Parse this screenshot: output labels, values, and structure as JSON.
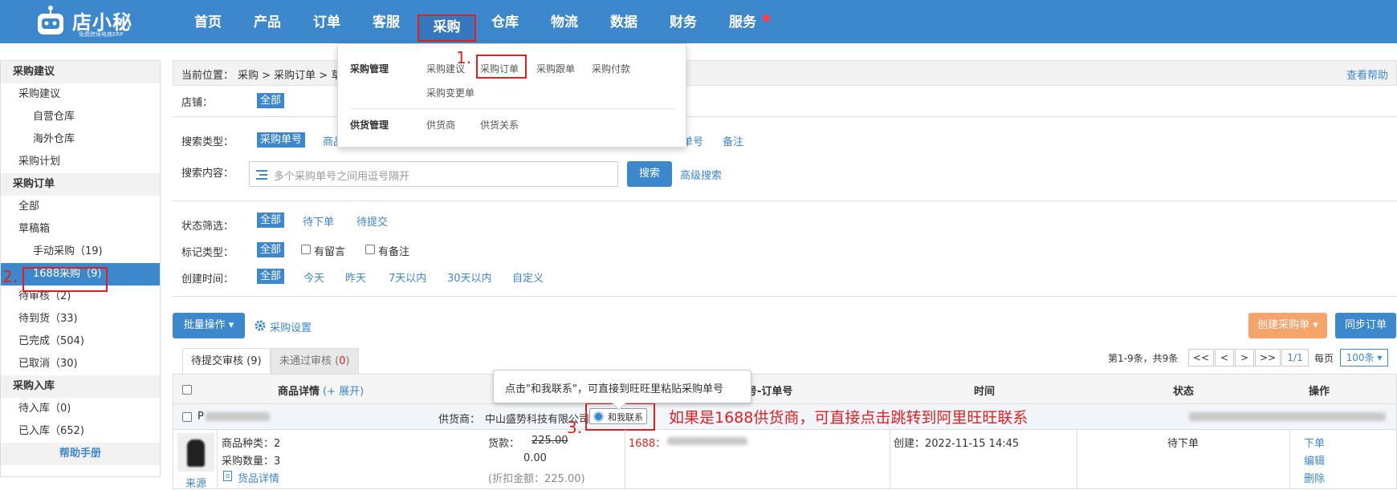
{
  "logo": {
    "name": "店小秘",
    "subtitle": "免费跨境电商ERP"
  },
  "nav": [
    "首页",
    "产品",
    "订单",
    "客服",
    "采购",
    "仓库",
    "物流",
    "数据",
    "财务",
    "服务"
  ],
  "sidebar": {
    "sections": [
      {
        "title": "采购建议",
        "items": [
          {
            "label": "采购建议"
          },
          {
            "label": "自营仓库"
          },
          {
            "label": "海外仓库"
          },
          {
            "label": "采购计划"
          }
        ]
      },
      {
        "title": "采购订单",
        "items": [
          {
            "label": "全部"
          },
          {
            "label": "草稿箱"
          },
          {
            "label": "手动采购（19)"
          },
          {
            "label": "1688采购（9)"
          },
          {
            "label": "待审核（2)"
          },
          {
            "label": "待到货（33)"
          },
          {
            "label": "已完成（504)"
          },
          {
            "label": "已取消（30)"
          }
        ]
      },
      {
        "title": "采购入库",
        "items": [
          {
            "label": "待入库（0)"
          },
          {
            "label": "已入库（652)"
          }
        ]
      }
    ],
    "help": "帮助手册"
  },
  "annotations": {
    "m1": "1.",
    "m2": "2.",
    "m3": "3.",
    "note": "如果是1688供货商，可直接点击跳转到阿里旺旺联系"
  },
  "breadcrumb": {
    "label": "当前位置：",
    "path": "采购 > 采购订单 > 草稿",
    "help": "查看帮助"
  },
  "dropdown": {
    "group1": "采购管理",
    "g1_items": [
      "采购建议",
      "采购订单",
      "采购跟单",
      "采购付款",
      "采购变更单"
    ],
    "group2": "供货管理",
    "g2_items": [
      "供货商",
      "供货关系"
    ]
  },
  "filters": {
    "shop_label": "店铺：",
    "shop_all": "全部",
    "type_label": "搜索类型：",
    "type_sel": "采购单号",
    "type_opt2": "商品",
    "type_opt3": "单号",
    "type_opt4": "备注",
    "content_label": "搜索内容：",
    "search_placeholder": "多个采购单号之间用逗号隔开",
    "search_btn": "搜索",
    "adv_search": "高级搜索",
    "status_label": "状态筛选：",
    "status_all": "全部",
    "status_1": "待下单",
    "status_2": "待提交",
    "mark_label": "标记类型：",
    "mark_all": "全部",
    "mark_1": "有留言",
    "mark_2": "有备注",
    "time_label": "创建时间：",
    "time_all": "全部",
    "time_1": "今天",
    "time_2": "昨天",
    "time_3": "7天以内",
    "time_4": "30天以内",
    "time_5": "自定义"
  },
  "toolbar": {
    "batch": "批量操作 ▾",
    "settings": "采购设置",
    "create": "创建采购单 ▾",
    "sync": "同步订单"
  },
  "tabs": {
    "t1": "待提交审核 (9)",
    "t2": "未通过审核 (",
    "t2_count": "0",
    "t2_end": ")"
  },
  "pager": {
    "summary": "第1-9条，共9条",
    "first": "<<",
    "prev": "<",
    "next": ">",
    "last": ">>",
    "page": "1/1",
    "per_label": "每页",
    "per": "100条"
  },
  "table": {
    "headers": {
      "product": "商品详情",
      "expand": "(+ 展开)",
      "order": "号-订单号",
      "time": "时间",
      "status": "状态",
      "ops": "操作"
    },
    "row": {
      "po_prefix": "P",
      "supplier_label": "供货商：",
      "supplier": "中山盛势科技有限公司",
      "contact": "和我联系",
      "source": "来源",
      "kinds": "商品种类：2",
      "qty": "采购数量：3",
      "detail": "货品详情",
      "price_label": "货款：",
      "price": "225.00",
      "price2": "0.00",
      "discount": "(折扣金额：225.00)",
      "order_prefix": "1688：",
      "created": "创建：2022-11-15 14:45",
      "status": "待下单",
      "op1": "下单",
      "op2": "编辑",
      "op3": "删除"
    }
  },
  "tooltip": "点击\"和我联系\"，可直接到旺旺里粘贴采购单号"
}
